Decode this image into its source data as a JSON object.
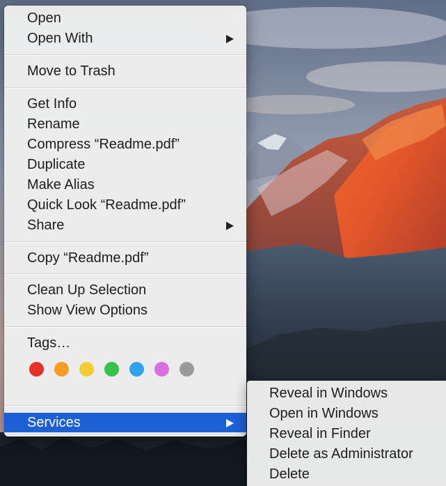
{
  "menu": {
    "items": [
      {
        "label": "Open"
      },
      {
        "label": "Open With"
      },
      {
        "label": "Move to Trash"
      },
      {
        "label": "Get Info"
      },
      {
        "label": "Rename"
      },
      {
        "label": "Compress “Readme.pdf”"
      },
      {
        "label": "Duplicate"
      },
      {
        "label": "Make Alias"
      },
      {
        "label": "Quick Look “Readme.pdf”"
      },
      {
        "label": "Share"
      },
      {
        "label": "Copy “Readme.pdf”"
      },
      {
        "label": "Clean Up Selection"
      },
      {
        "label": "Show View Options"
      },
      {
        "label": "Tags…"
      },
      {
        "label": "Services"
      }
    ],
    "tag_colors": [
      "#e8302b",
      "#f39c26",
      "#f5cc2e",
      "#34c447",
      "#2fa3ee",
      "#d66fdf",
      "#9a9a9a"
    ],
    "highlight_color": "#1f5fd6"
  },
  "services": {
    "items": [
      {
        "label": "Reveal in Windows"
      },
      {
        "label": "Open in Windows"
      },
      {
        "label": "Reveal in Finder"
      },
      {
        "label": "Delete as Administrator"
      },
      {
        "label": "Delete"
      }
    ]
  }
}
